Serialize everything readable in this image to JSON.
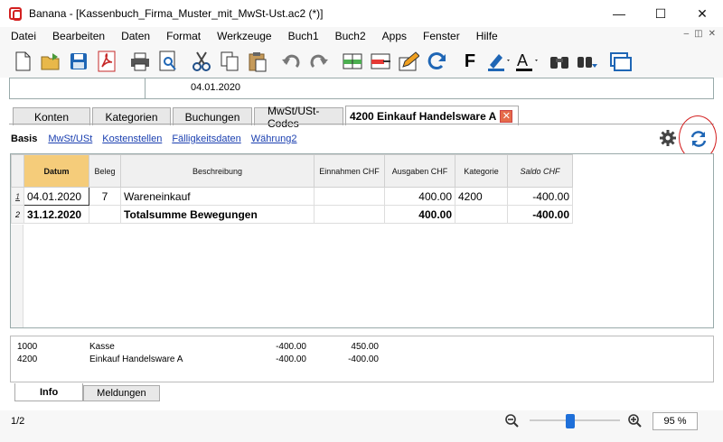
{
  "window": {
    "title": "Banana - [Kassenbuch_Firma_Muster_mit_MwSt-Ust.ac2 (*)]"
  },
  "menu": [
    "Datei",
    "Bearbeiten",
    "Daten",
    "Format",
    "Werkzeuge",
    "Buch1",
    "Buch2",
    "Apps",
    "Fenster",
    "Hilfe"
  ],
  "cellbar": {
    "value": "04.01.2020"
  },
  "tabs": [
    "Konten",
    "Kategorien",
    "Buchungen",
    "MwSt/USt-Codes",
    "4200 Einkauf Handelsware A"
  ],
  "views": [
    "Basis",
    "MwSt/USt",
    "Kostenstellen",
    "Fälligkeitsdaten",
    "Währung2"
  ],
  "table": {
    "headers": [
      "Datum",
      "Beleg",
      "Beschreibung",
      "Einnahmen CHF",
      "Ausgaben CHF",
      "Kategorie",
      "Saldo CHF"
    ],
    "rows": [
      {
        "n": "1",
        "datum": "04.01.2020",
        "beleg": "7",
        "beschreibung": "Wareneinkauf",
        "einnahmen": "",
        "ausgaben": "400.00",
        "kategorie": "4200",
        "saldo": "-400.00"
      },
      {
        "n": "2",
        "datum": "31.12.2020",
        "beleg": "",
        "beschreibung": "Totalsumme Bewegungen",
        "einnahmen": "",
        "ausgaben": "400.00",
        "kategorie": "",
        "saldo": "-400.00"
      }
    ]
  },
  "info": [
    {
      "konto": "1000",
      "name": "Kasse",
      "a": "-400.00",
      "b": "450.00"
    },
    {
      "konto": "4200",
      "name": "Einkauf Handelsware A",
      "a": "-400.00",
      "b": "-400.00"
    }
  ],
  "bottom_tabs": [
    "Info",
    "Meldungen"
  ],
  "status": {
    "page": "1/2",
    "zoom": "95 %",
    "zoom_level": 0.5
  }
}
